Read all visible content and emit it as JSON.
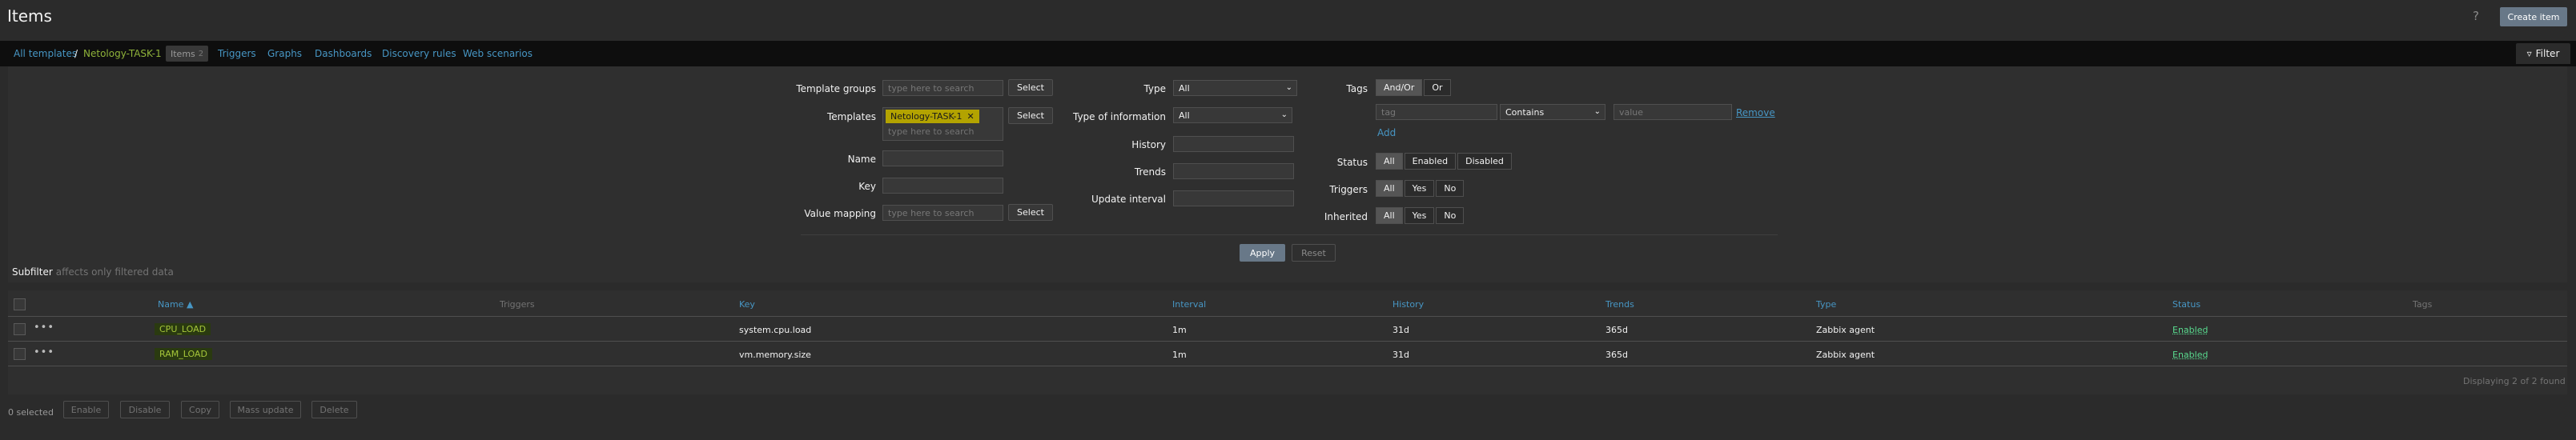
{
  "page": {
    "title": "Items",
    "create_button": "Create item",
    "help_icon": "?"
  },
  "nav": {
    "all_templates": "All templates",
    "separator": "/",
    "template_name": "Netology-TASK-1",
    "items_tab": "Items",
    "items_count": "2",
    "triggers": "Triggers",
    "graphs": "Graphs",
    "dashboards": "Dashboards",
    "discovery_rules": "Discovery rules",
    "web_scenarios": "Web scenarios",
    "filter": "Filter"
  },
  "filter": {
    "template_groups_label": "Template groups",
    "template_groups_placeholder": "type here to search",
    "select": "Select",
    "templates_label": "Templates",
    "template_chip": "Netology-TASK-1",
    "templates_placeholder": "type here to search",
    "name_label": "Name",
    "key_label": "Key",
    "value_mapping_label": "Value mapping",
    "value_mapping_placeholder": "type here to search",
    "type_label": "Type",
    "type_value": "All",
    "type_of_information_label": "Type of information",
    "type_of_information_value": "All",
    "history_label": "History",
    "trends_label": "Trends",
    "update_interval_label": "Update interval",
    "tags_label": "Tags",
    "andor": "And/Or",
    "or": "Or",
    "tag_placeholder": "tag",
    "tag_operator": "Contains",
    "value_placeholder": "value",
    "remove": "Remove",
    "add": "Add",
    "status_label": "Status",
    "status_all": "All",
    "status_enabled": "Enabled",
    "status_disabled": "Disabled",
    "triggers_label": "Triggers",
    "inherited_label": "Inherited",
    "all": "All",
    "yes": "Yes",
    "no": "No",
    "apply": "Apply",
    "reset": "Reset"
  },
  "subfilter": {
    "title": "Subfilter",
    "note": "affects only filtered data"
  },
  "table": {
    "headers": {
      "name": "Name ▲",
      "triggers": "Triggers",
      "key": "Key",
      "interval": "Interval",
      "history": "History",
      "trends": "Trends",
      "type": "Type",
      "status": "Status",
      "tags": "Tags"
    },
    "rows": [
      {
        "name": "CPU_LOAD",
        "key": "system.cpu.load",
        "interval": "1m",
        "history": "31d",
        "trends": "365d",
        "type": "Zabbix agent",
        "status": "Enabled"
      },
      {
        "name": "RAM_LOAD",
        "key": "vm.memory.size",
        "interval": "1m",
        "history": "31d",
        "trends": "365d",
        "type": "Zabbix agent",
        "status": "Enabled"
      }
    ],
    "displaying": "Displaying 2 of 2 found",
    "row_menu": "•••"
  },
  "actions": {
    "selected": "0 selected",
    "enable": "Enable",
    "disable": "Disable",
    "copy": "Copy",
    "mass_update": "Mass update",
    "delete": "Delete"
  },
  "colors": {
    "accent": "#4796c4",
    "enabled": "#59db8f",
    "chip": "#b3a300",
    "primary_button": "#687888"
  }
}
